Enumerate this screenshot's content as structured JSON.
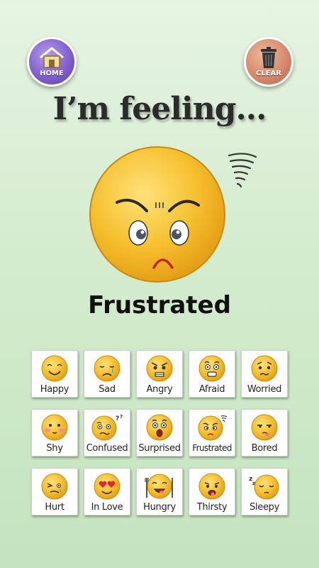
{
  "header": {
    "home_label": "HOME",
    "clear_label": "CLEAR",
    "title": "I’m feeling..."
  },
  "current": {
    "emotion": "Frustrated",
    "icon": "frustrated-face-with-tornado"
  },
  "colors": {
    "home_button": "#7c5ccc",
    "clear_button": "#d3866a",
    "face_yellow": "#f6c131",
    "background": "#d4ecce"
  },
  "emotions": [
    {
      "label": "Happy",
      "icon": "happy-face-icon"
    },
    {
      "label": "Sad",
      "icon": "sad-face-icon"
    },
    {
      "label": "Angry",
      "icon": "angry-face-icon"
    },
    {
      "label": "Afraid",
      "icon": "afraid-face-icon"
    },
    {
      "label": "Worried",
      "icon": "worried-face-icon"
    },
    {
      "label": "Shy",
      "icon": "shy-face-icon"
    },
    {
      "label": "Confused",
      "icon": "confused-face-icon"
    },
    {
      "label": "Surprised",
      "icon": "surprised-face-icon"
    },
    {
      "label": "Frustrated",
      "icon": "frustrated-face-icon"
    },
    {
      "label": "Bored",
      "icon": "bored-face-icon"
    },
    {
      "label": "Hurt",
      "icon": "hurt-face-icon"
    },
    {
      "label": "In Love",
      "icon": "in-love-face-icon"
    },
    {
      "label": "Hungry",
      "icon": "hungry-face-icon"
    },
    {
      "label": "Thirsty",
      "icon": "thirsty-face-icon"
    },
    {
      "label": "Sleepy",
      "icon": "sleepy-face-icon"
    }
  ]
}
